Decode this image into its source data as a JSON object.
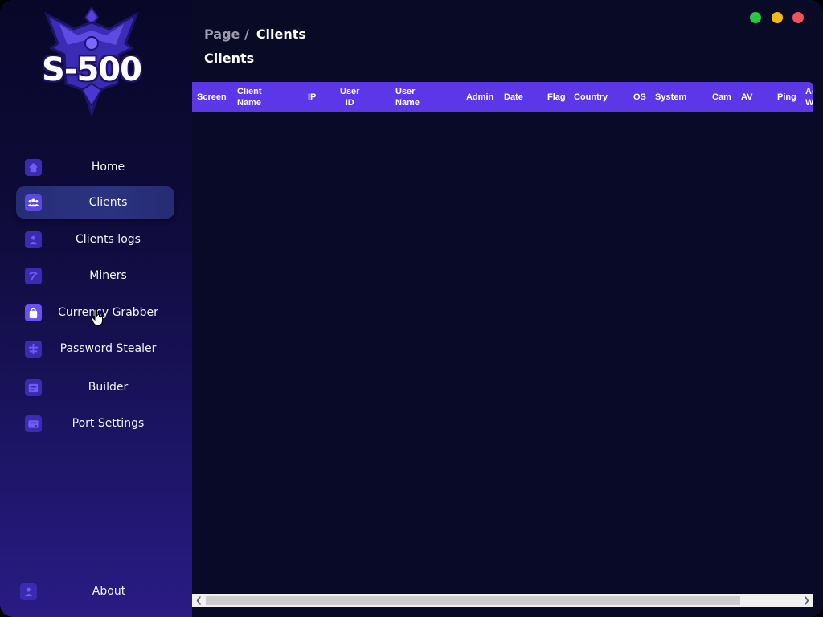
{
  "app": {
    "logo_text": "S-500"
  },
  "window_controls": [
    {
      "name": "maximize",
      "color": "#27c93f"
    },
    {
      "name": "minimize",
      "color": "#f5b915"
    },
    {
      "name": "close",
      "color": "#f0525a"
    }
  ],
  "breadcrumb": {
    "root": "Page /",
    "current": "Clients"
  },
  "page_title": "Clients",
  "sidebar": {
    "items": [
      {
        "label": "Home",
        "icon": "home-icon",
        "active": false
      },
      {
        "label": "Clients",
        "icon": "users-icon",
        "active": true
      },
      {
        "label": "Clients logs",
        "icon": "user-icon",
        "active": false
      },
      {
        "label": "Miners",
        "icon": "pickaxe-icon",
        "active": false
      },
      {
        "label": "Currency Grabber",
        "icon": "bag-icon",
        "active": false
      },
      {
        "label": "Password Stealer",
        "icon": "key-icon",
        "active": false
      },
      {
        "label": "Builder",
        "icon": "build-icon",
        "active": false
      },
      {
        "label": "Port Settings",
        "icon": "port-icon",
        "active": false
      }
    ],
    "about": {
      "label": "About",
      "icon": "person-icon"
    }
  },
  "table": {
    "columns": [
      "Screen",
      "Client\nName",
      "IP",
      "User\nID",
      "User\nName",
      "Admin",
      "Date",
      "Flag",
      "Country",
      "OS",
      "System",
      "Cam",
      "AV",
      "Ping",
      "Ac\nW"
    ],
    "rows": []
  },
  "colors": {
    "accent": "#5b37e8",
    "content_bg": "#080a27",
    "active_nav": "#2b3380"
  }
}
